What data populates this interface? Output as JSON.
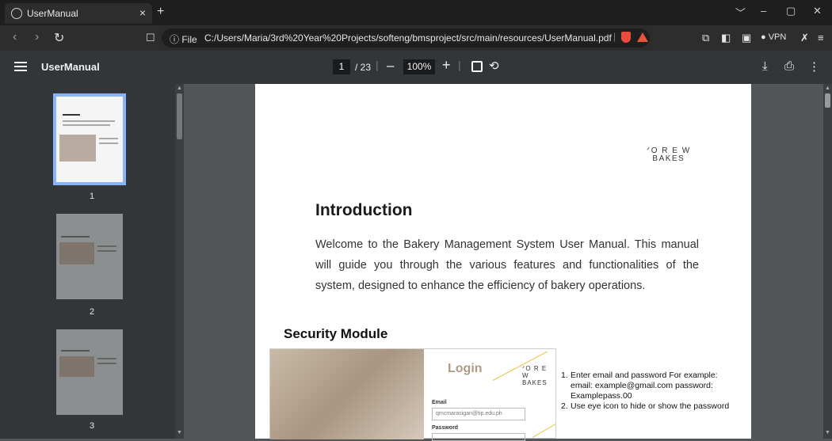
{
  "browser": {
    "tab_title": "UserManual",
    "tab_close": "×",
    "new_tab": "+",
    "url_scheme_label": "ⓘ File",
    "url": "C:/Users/Maria/3rd%20Year%20Projects/softeng/bmsproject/src/main/resources/UserManual.pdf",
    "vpn_label": "● VPN"
  },
  "pdf_toolbar": {
    "doc_title": "UserManual",
    "current_page": "1",
    "total_pages": "/ 23",
    "zoom": "100%",
    "zoom_out": "–",
    "zoom_in": "+"
  },
  "thumbnails": [
    {
      "page": "1"
    },
    {
      "page": "2"
    },
    {
      "page": "3"
    }
  ],
  "pdf_page": {
    "logo_line1": "ᐟO R E W",
    "logo_line2": "BAKES",
    "heading": "Introduction",
    "paragraph": "Welcome to the Bakery Management System User Manual. This manual will guide you through the various features and functionalities of the system, designed to enhance the efficiency of bakery operations.",
    "section_heading": "Security Module",
    "screenshot": {
      "login_title": "Login",
      "logo_line1": "ᐟO R E W",
      "logo_line2": "BAKES",
      "email_label": "Email",
      "email_value": "qmcmarasigan@tip.edu.ph",
      "password_label": "Password"
    },
    "notes": [
      {
        "num": "1.",
        "text": "Enter email and password For example: email: example@gmail.com password: Examplepass.00"
      },
      {
        "num": "2.",
        "text": "Use eye icon to hide or show the password"
      }
    ]
  }
}
